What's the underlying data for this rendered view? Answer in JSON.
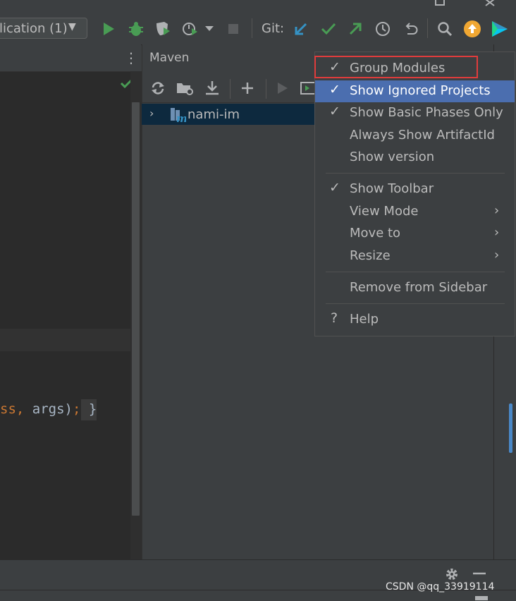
{
  "toolbar": {
    "run_config_label": "lication (1)",
    "git_label": "Git:"
  },
  "editor": {
    "code_line": {
      "part1": "ss, ",
      "part2": "args)",
      "part3": ";",
      "part4": " }"
    }
  },
  "maven": {
    "title": "Maven",
    "tree_root": "nami-im"
  },
  "menu": {
    "items": [
      {
        "label": "Group Modules",
        "checked": true
      },
      {
        "label": "Show Ignored Projects",
        "checked": true,
        "selected": true
      },
      {
        "label": "Show Basic Phases Only",
        "checked": true
      },
      {
        "label": "Always Show ArtifactId",
        "checked": false
      },
      {
        "label": "Show version",
        "checked": false
      },
      {
        "label": "Show Toolbar",
        "checked": true
      },
      {
        "label": "View Mode",
        "submenu": true
      },
      {
        "label": "Move to",
        "submenu": true
      },
      {
        "label": "Resize",
        "submenu": true
      },
      {
        "label": "Remove from Sidebar"
      },
      {
        "label": "Help",
        "icon": "help-icon"
      }
    ],
    "check_glyph": "✓",
    "help_glyph": "?",
    "submenu_glyph": "›"
  },
  "colors": {
    "selection": "#4b6eaf",
    "tree_selection": "#0d293e",
    "highlight_border": "#e03c3c",
    "run_green": "#499c54",
    "git_blue": "#3592c4"
  },
  "watermark": "CSDN @qq_33919114"
}
